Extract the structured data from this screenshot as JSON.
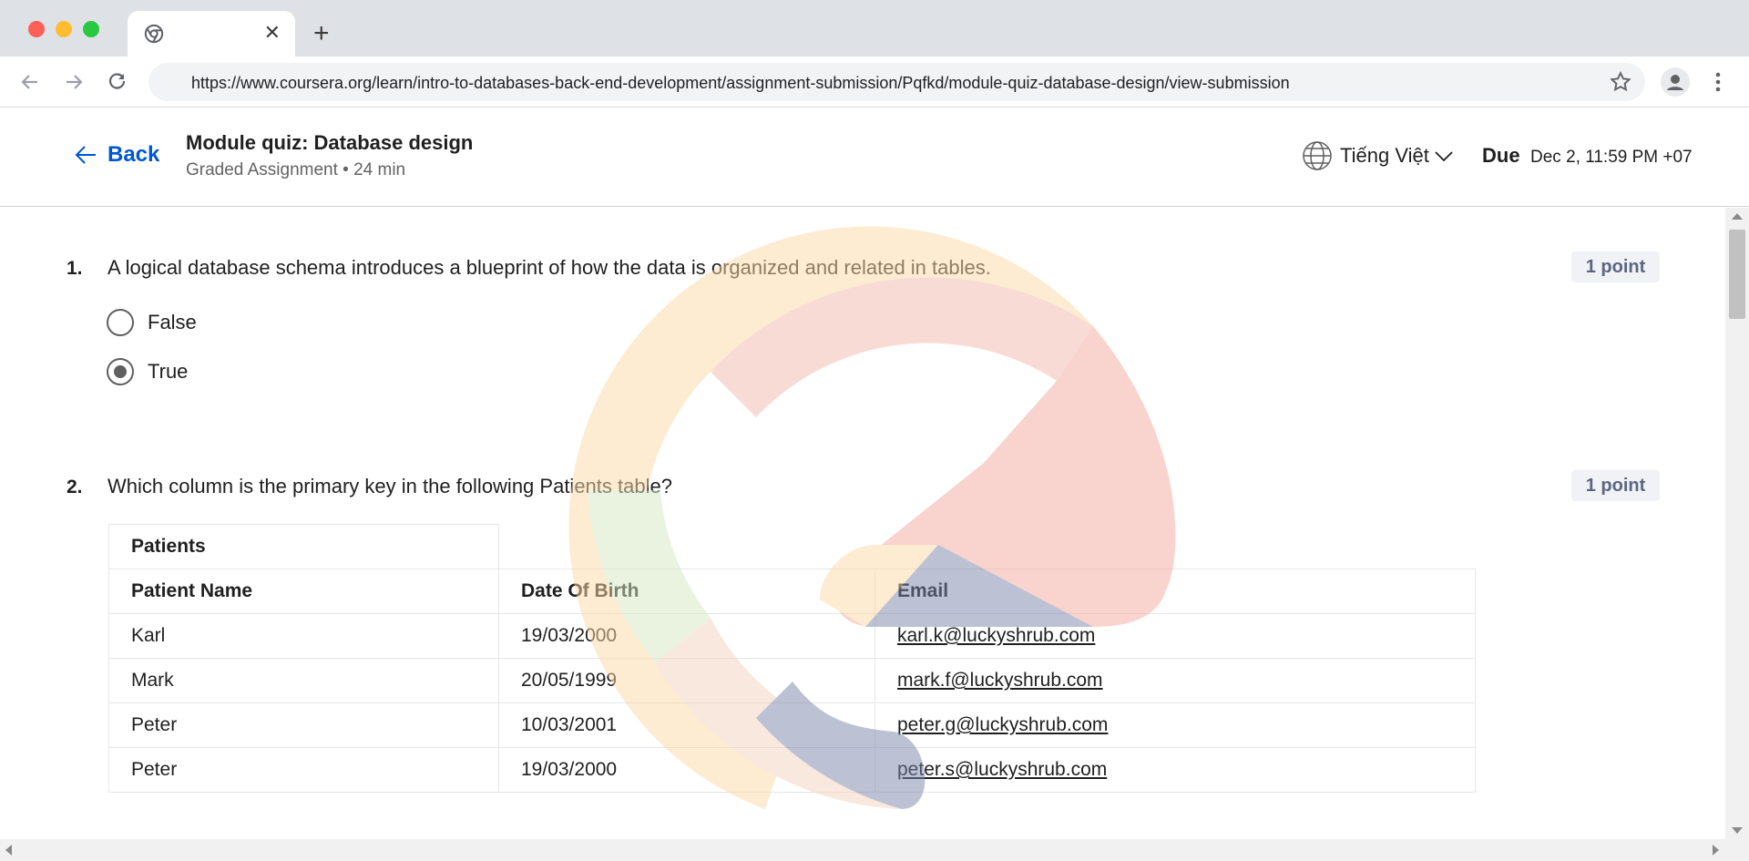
{
  "browser": {
    "url": "https://www.coursera.org/learn/intro-to-databases-back-end-development/assignment-submission/Pqfkd/module-quiz-database-design/view-submission",
    "tab_close": "✕",
    "new_tab": "+"
  },
  "header": {
    "back_label": "Back",
    "title": "Module quiz: Database design",
    "subtitle": "Graded Assignment • 24 min",
    "language": "Tiếng Việt",
    "due_label": "Due",
    "due_value": "Dec 2, 11:59 PM +07"
  },
  "questions": [
    {
      "number": "1.",
      "text": "A logical database schema introduces a blueprint of how the data is organized and related in tables.",
      "points": "1 point",
      "options": [
        {
          "label": "False",
          "selected": false
        },
        {
          "label": "True",
          "selected": true
        }
      ]
    },
    {
      "number": "2.",
      "text": "Which column is the primary key in the following Patients table?",
      "points": "1 point",
      "table": {
        "caption": "Patients",
        "headers": [
          "Patient Name",
          "Date Of Birth",
          "Email"
        ],
        "rows": [
          [
            "Karl",
            "19/03/2000",
            "karl.k@luckyshrub.com"
          ],
          [
            "Mark",
            "20/05/1999",
            "mark.f@luckyshrub.com"
          ],
          [
            "Peter",
            "10/03/2001",
            "peter.g@luckyshrub.com"
          ],
          [
            "Peter",
            "19/03/2000",
            "peter.s@luckyshrub.com"
          ]
        ]
      }
    }
  ],
  "colors": {
    "brand_blue": "#0056d2",
    "points_badge_bg": "#f0f2f5",
    "points_badge_text": "#5b6780"
  }
}
